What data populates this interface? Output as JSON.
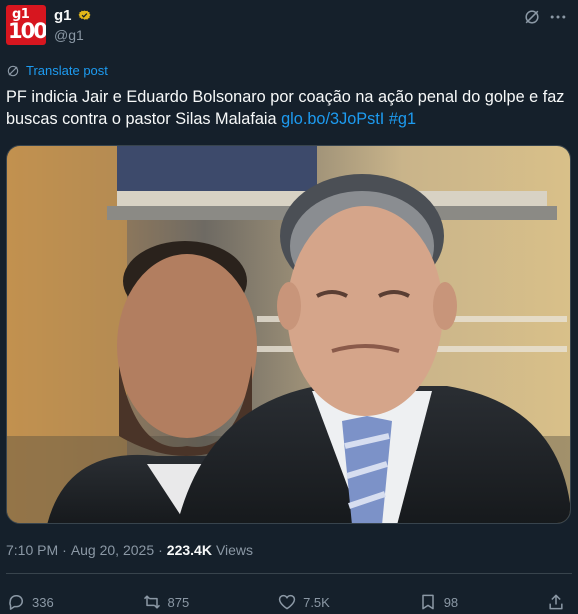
{
  "author": {
    "avatar_text_top": "g1",
    "avatar_text_bottom": "100",
    "display_name": "g1",
    "handle": "@g1",
    "verified": true
  },
  "header_icons": [
    "grok-icon",
    "more-icon"
  ],
  "translate": {
    "label": "Translate post"
  },
  "tweet": {
    "text": "PF indicia Jair e Eduardo Bolsonaro por coação na ação penal do golpe e faz buscas contra o pastor Silas Malafaia ",
    "link": "glo.bo/3JoPstI",
    "hashtag": "#g1"
  },
  "media": {
    "alt": "photo"
  },
  "meta": {
    "time": "7:10 PM",
    "separator": "·",
    "date": "Aug 20, 2025",
    "views_count": "223.4K",
    "views_label": "Views"
  },
  "actions": {
    "replies": "336",
    "reposts": "875",
    "likes": "7.5K",
    "bookmarks": "98"
  },
  "colors": {
    "background": "#15202b",
    "accent": "#1d9bf0",
    "secondary_text": "#8b98a5",
    "brand_red": "#d7161f"
  }
}
